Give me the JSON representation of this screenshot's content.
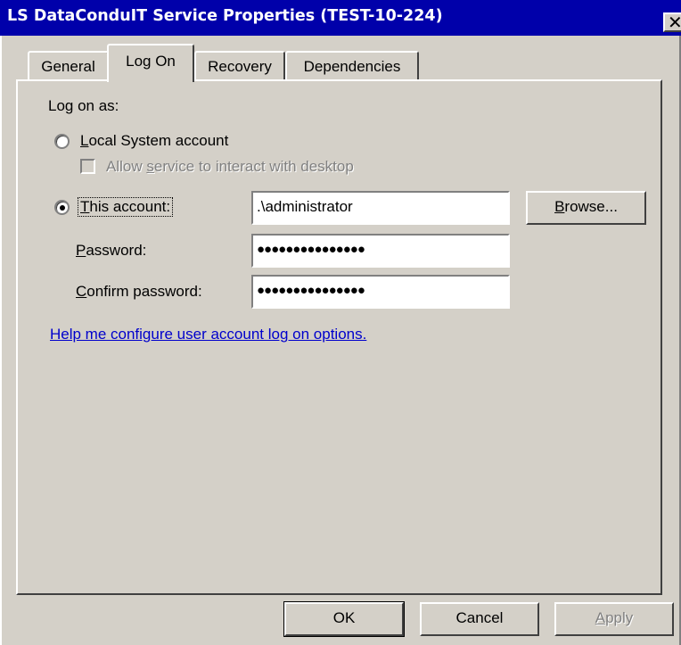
{
  "window": {
    "title": "LS DataConduIT Service Properties (TEST-10-224)",
    "close_glyph": "✕"
  },
  "tabs": [
    {
      "label": "General",
      "active": false
    },
    {
      "label": "Log On",
      "active": true
    },
    {
      "label": "Recovery",
      "active": false
    },
    {
      "label": "Dependencies",
      "active": false
    }
  ],
  "logon": {
    "log_on_as_label": "Log on as:",
    "local_system": {
      "prefix": "",
      "accel": "L",
      "rest": "ocal System account",
      "selected": false
    },
    "allow_desktop": {
      "prefix": "Allow ",
      "accel": "s",
      "rest": "ervice to interact with desktop",
      "checked": false,
      "enabled": false
    },
    "this_account": {
      "prefix": "",
      "accel": "T",
      "rest": "his account:",
      "selected": true,
      "value": ".\\administrator"
    },
    "browse_button": {
      "prefix": "",
      "accel": "B",
      "rest": "rowse..."
    },
    "password": {
      "prefix": "",
      "accel": "P",
      "rest": "assword:",
      "masked_value": "●●●●●●●●●●●●●●●"
    },
    "confirm_password": {
      "prefix": "",
      "accel": "C",
      "rest": "onfirm password:",
      "masked_value": "●●●●●●●●●●●●●●●"
    },
    "help_link": "Help me configure user account log on options."
  },
  "footer": {
    "ok_label": "OK",
    "cancel_label": "Cancel",
    "apply_prefix": "",
    "apply_accel": "A",
    "apply_rest": "pply",
    "apply_enabled": false
  }
}
